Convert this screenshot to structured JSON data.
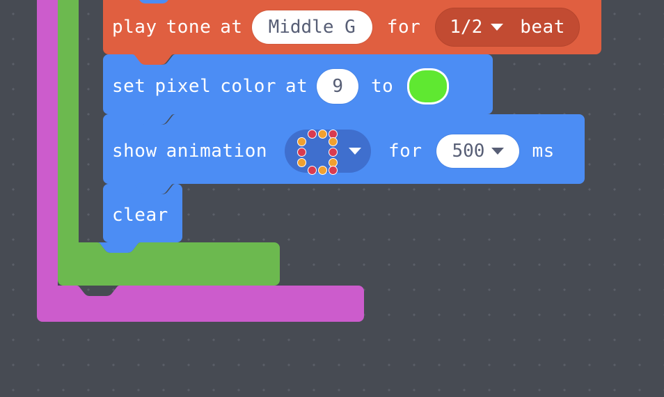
{
  "editor": {
    "name": "block-editor-canvas",
    "background_color": "#474b53",
    "grid_dot_color": "#5b5f68",
    "grid_spacing_px": 36
  },
  "palette": {
    "music_orange": "#e05f40",
    "music_orange_dark": "#c24b32",
    "light_blue": "#4c8df4",
    "light_blue_dark": "#3f6fce",
    "green": "#6cb94f",
    "magenta": "#cc5ccc",
    "white": "#ffffff",
    "field_text": "#575e75"
  },
  "blocks": {
    "outer_loop": {
      "name": "magenta-c-block",
      "color": "#cc5ccc",
      "label": ""
    },
    "inner_loop": {
      "name": "green-c-block",
      "color": "#6cb94f",
      "label": ""
    },
    "play_tone": {
      "name": "play-tone-block",
      "color": "#e05f40",
      "words": {
        "w1": "play",
        "w2": "tone",
        "w3": "at",
        "w4": "for",
        "w5": "beat"
      },
      "note_field": {
        "value": "Middle G",
        "type": "note-picker"
      },
      "duration_field": {
        "value": "1/2",
        "type": "dropdown",
        "caret": "chevron-down-icon"
      }
    },
    "set_pixel_color": {
      "name": "set-pixel-color-block",
      "color": "#4c8df4",
      "words": {
        "w1": "set",
        "w2": "pixel",
        "w3": "color",
        "w4": "at",
        "w5": "to"
      },
      "index_field": {
        "value": "9",
        "type": "number-input"
      },
      "color_field": {
        "value": "#5fe831",
        "type": "color-swatch"
      }
    },
    "show_animation": {
      "name": "show-animation-block",
      "color": "#4c8df4",
      "words": {
        "w1": "show",
        "w2": "animation",
        "w3": "for",
        "w4": "ms"
      },
      "animation_field": {
        "value": "rainbow-ring-animation",
        "type": "animation-picker",
        "caret": "chevron-down-icon",
        "dot_colors": [
          "#d93b50",
          "#f0a030"
        ]
      },
      "duration_field": {
        "value": "500",
        "type": "dropdown",
        "caret": "chevron-down-icon"
      }
    },
    "clear": {
      "name": "clear-block",
      "color": "#4c8df4",
      "label": "clear"
    }
  }
}
